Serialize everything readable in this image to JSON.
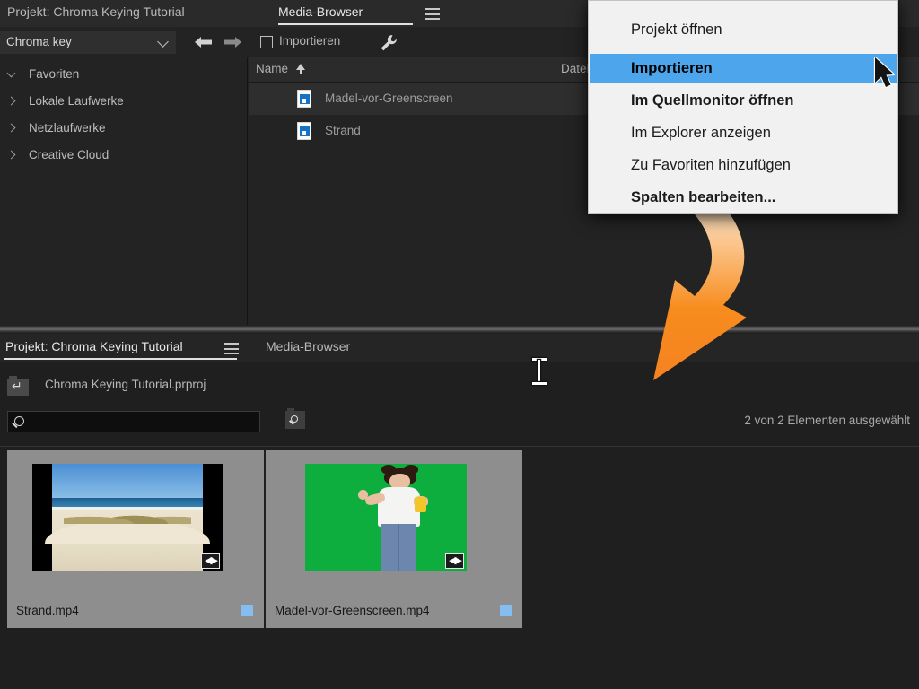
{
  "media_browser": {
    "tabs": [
      {
        "label": "Projekt: Chroma Keying Tutorial",
        "active": false
      },
      {
        "label": "Media-Browser",
        "active": true
      }
    ],
    "menu_icon": "hamburger-icon",
    "toolbar": {
      "folder_value": "Chroma key",
      "back_icon": "arrow-left-icon",
      "forward_icon": "arrow-right-icon",
      "import_checkbox_label": "Importieren",
      "import_checked": false,
      "settings_icon": "wrench-icon"
    },
    "sidebar": {
      "items": [
        {
          "label": "Favoriten",
          "expanded": true
        },
        {
          "label": "Lokale Laufwerke",
          "expanded": false
        },
        {
          "label": "Netzlaufwerke",
          "expanded": false
        },
        {
          "label": "Creative Cloud",
          "expanded": false
        }
      ]
    },
    "file_list": {
      "columns": [
        "Name",
        "Dateipfad"
      ],
      "sort_column": "Name",
      "sort_direction": "ascending",
      "rows": [
        {
          "name": "Madel-vor-Greenscreen",
          "path": "",
          "selected": true
        },
        {
          "name": "Strand",
          "path": "",
          "selected": false
        }
      ]
    }
  },
  "context_menu": {
    "items": [
      {
        "label": "Projekt öffnen",
        "highlighted": false,
        "bold": false
      },
      {
        "label": "Importieren",
        "highlighted": true,
        "bold": true
      },
      {
        "label": "Im Quellmonitor öffnen",
        "highlighted": false,
        "bold": true
      },
      {
        "label": "Im Explorer anzeigen",
        "highlighted": false,
        "bold": false
      },
      {
        "label": "Zu Favoriten hinzufügen",
        "highlighted": false,
        "bold": false
      },
      {
        "label": "Spalten bearbeiten...",
        "highlighted": false,
        "bold": true
      }
    ],
    "highlight_color": "#4da6ec",
    "cursor_icon": "mouse-pointer-icon"
  },
  "annotation": {
    "arrow_icon": "curved-arrow-icon",
    "arrow_color": "#f58220"
  },
  "project_panel": {
    "tabs": [
      {
        "label": "Projekt: Chroma Keying Tutorial",
        "active": true
      },
      {
        "label": "Media-Browser",
        "active": false
      }
    ],
    "menu_icon": "hamburger-icon",
    "project_file": "Chroma Keying Tutorial.prproj",
    "project_icon": "project-folder-icon",
    "search": {
      "value": "",
      "placeholder": "",
      "icon": "search-icon"
    },
    "find_icon": "find-in-project-icon",
    "status": "2 von 2 Elementen ausgewählt",
    "text_cursor_icon": "text-ibeam-cursor",
    "thumbnails": [
      {
        "caption": "Strand.mp4",
        "kind": "beach",
        "badge_color": "#86bdf0",
        "video_icon": "video-clip-icon"
      },
      {
        "caption": "Madel-vor-Greenscreen.mp4",
        "kind": "greenscreen",
        "badge_color": "#86bdf0",
        "video_icon": "video-clip-icon"
      }
    ]
  }
}
